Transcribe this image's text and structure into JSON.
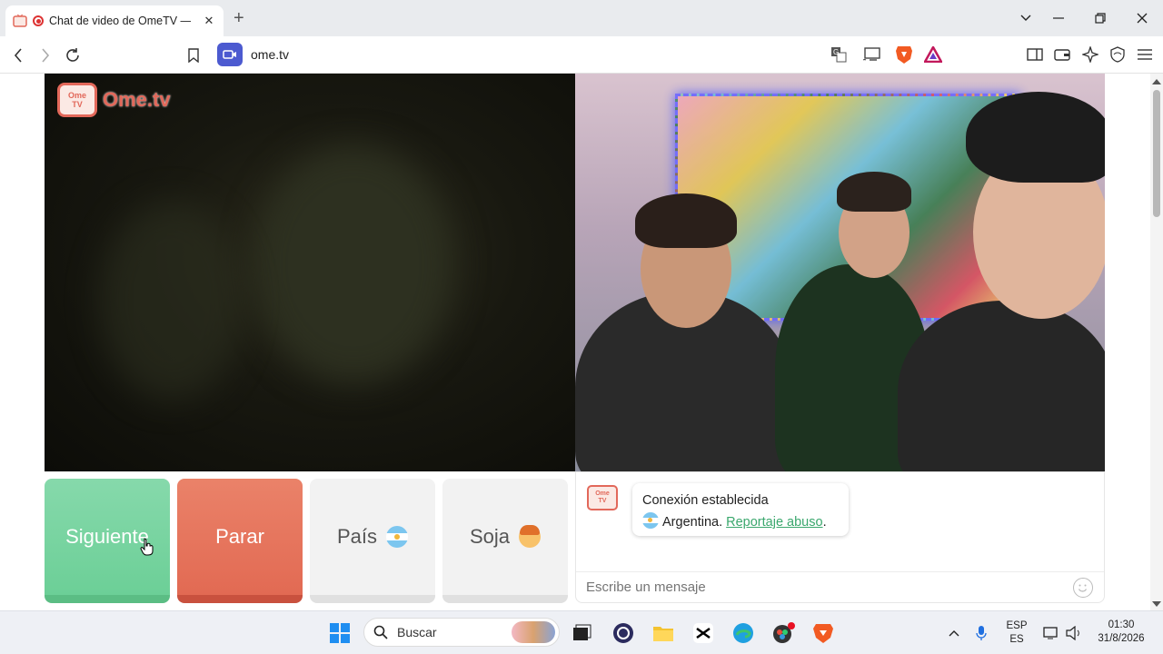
{
  "browser": {
    "tab_title": "Chat de video de OmeTV — A",
    "tab_close": "✕",
    "new_tab": "+",
    "url": "ome.tv",
    "window_controls": [
      "chevron-down",
      "minimize",
      "restore",
      "close"
    ]
  },
  "page": {
    "logo_tv_top": "Ome",
    "logo_tv_bottom": "TV",
    "logo_word": "Ome.tv",
    "buttons": {
      "next": "Siguiente",
      "stop": "Parar",
      "country": "País",
      "gender": "Soja"
    },
    "chat": {
      "avatar_top": "Ome",
      "avatar_bottom": "TV",
      "status": "Conexión establecida",
      "country": "Argentina.",
      "report_link": "Reportaje abuso",
      "report_suffix": ".",
      "input_placeholder": "Escribe un mensaje"
    }
  },
  "taskbar": {
    "search_placeholder": "Buscar",
    "lang_top": "ESP",
    "lang_bottom": "ES",
    "time": "01:30",
    "date": "31/8/2026",
    "brave_badge": "3"
  },
  "colors": {
    "next_green": "#6ccf97",
    "stop_red": "#e26a53",
    "brand": "#e2685a",
    "link_green": "#3aa76d",
    "site_icon_blue": "#4c5ad0"
  }
}
